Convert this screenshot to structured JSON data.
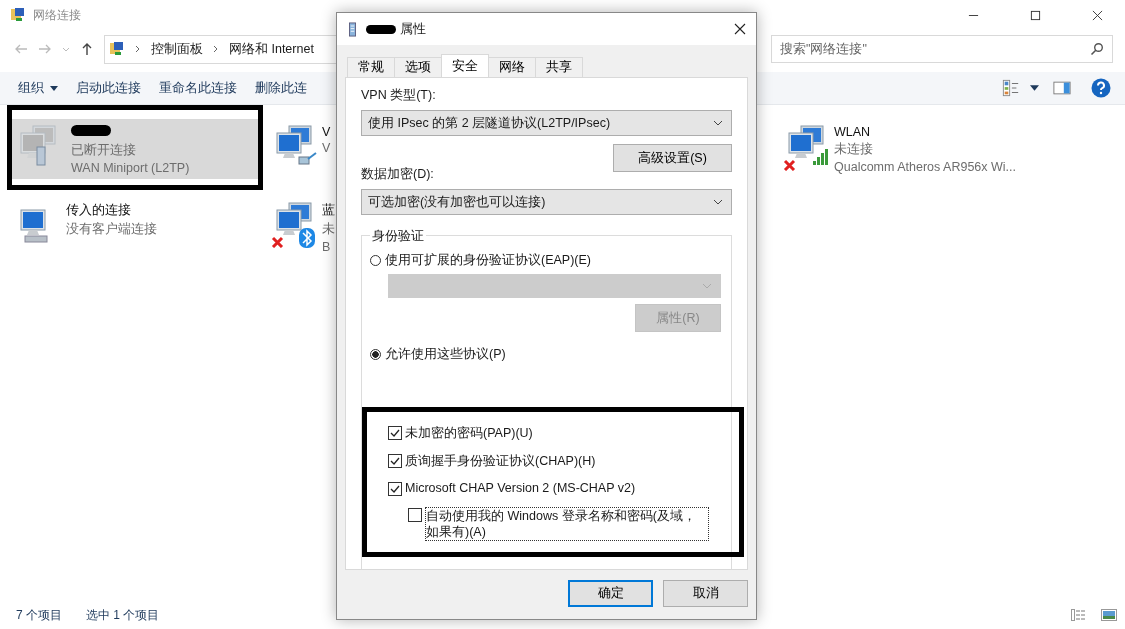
{
  "explorer": {
    "title": "网络连接",
    "breadcrumb": [
      "控制面板",
      "网络和 Internet"
    ],
    "search": {
      "placeholder": "搜索\"网络连接\""
    },
    "toolbar": [
      {
        "label": "组织",
        "dropdown": true
      },
      {
        "label": "启动此连接",
        "dropdown": false
      },
      {
        "label": "重命名此连接",
        "dropdown": false
      },
      {
        "label": "删除此连",
        "dropdown": false
      }
    ],
    "connections": [
      {
        "kind": "vpn",
        "redacted": true,
        "status": "已断开连接",
        "device": "WAN Miniport (L2TP)",
        "selected": true,
        "disconnected": false
      },
      {
        "kind": "ethernet",
        "name": "V",
        "status": "V",
        "selected": false,
        "disconnected": false
      },
      {
        "kind": "wifi",
        "name": "WLAN",
        "status": "未连接",
        "device": "Qualcomm Atheros AR956x Wi...",
        "selected": false,
        "disconnected": true
      },
      {
        "kind": "incoming",
        "name": "传入的连接",
        "status": "没有客户端连接",
        "selected": false,
        "disconnected": false
      },
      {
        "kind": "bluetooth",
        "name": "蓝",
        "status": "未",
        "device": "B",
        "selected": false,
        "disconnected": true
      }
    ],
    "status_bar": [
      "7 个项目",
      "选中 1 个项目"
    ]
  },
  "dialog": {
    "title": "属性",
    "redacted": true,
    "tabs": [
      {
        "label": "常规",
        "selected": false
      },
      {
        "label": "选项",
        "selected": false
      },
      {
        "label": "安全",
        "selected": true
      },
      {
        "label": "网络",
        "selected": false
      },
      {
        "label": "共享",
        "selected": false
      }
    ],
    "vpn_type": {
      "label": "VPN 类型(T):",
      "value": "使用 IPsec 的第 2 层隧道协议(L2TP/IPsec)"
    },
    "advanced_button": "高级设置(S)",
    "encryption": {
      "label": "数据加密(D):",
      "value": "可选加密(没有加密也可以连接)"
    },
    "auth": {
      "title": "身份验证",
      "eap": {
        "label": "使用可扩展的身份验证协议(EAP)(E)",
        "selected": false
      },
      "eap_dropdown": {
        "disabled": true
      },
      "properties_button": {
        "label": "属性(R)",
        "disabled": true
      },
      "protocols": {
        "label": "允许使用这些协议(P)",
        "selected": true
      },
      "checkboxes": [
        {
          "label": "未加密的密码(PAP)(U)",
          "checked": true,
          "indent": false
        },
        {
          "label": "质询握手身份验证协议(CHAP)(H)",
          "checked": true,
          "indent": false
        },
        {
          "label": "Microsoft CHAP Version 2 (MS-CHAP v2)",
          "checked": true,
          "indent": false
        },
        {
          "label": "自动使用我的 Windows 登录名称和密码(及域，如果有)(A)",
          "checked": false,
          "indent": true
        }
      ]
    },
    "buttons": [
      {
        "label": "确定",
        "default": true
      },
      {
        "label": "取消",
        "default": false
      }
    ]
  }
}
